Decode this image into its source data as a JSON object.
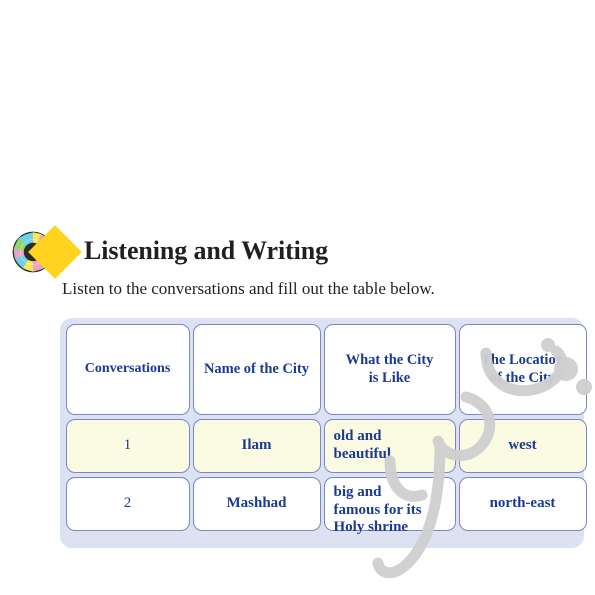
{
  "page": {
    "background": "#ffffff"
  },
  "header": {
    "icons": [
      {
        "name": "cd-disc-icon",
        "label": "cd-disc-icon"
      },
      {
        "name": "diamond-icon",
        "label": "diamond-icon",
        "color": "#ffd320"
      }
    ],
    "title": "Listening and Writing",
    "title_color": "#231f20"
  },
  "instruction": {
    "text": "Listen to the conversations and fill out the table below."
  },
  "table": {
    "panel_color": "#dde2f2",
    "border_color": "#7b87c4",
    "text_color": "#1b3a93",
    "row1_fill": "#fbfbe3",
    "row2_fill": "#ffffff",
    "headers": [
      "Conversations",
      "Name of the City",
      "What the City\nis Like",
      "The Location\nof the City"
    ],
    "headers_lines": [
      [
        "Conversations"
      ],
      [
        "Name of the City"
      ],
      [
        "What the City",
        "is Like"
      ],
      [
        "The Location",
        "of the City"
      ]
    ],
    "rows": [
      {
        "conversation": "1",
        "city": "Ilam",
        "what_is_like": "old and beautiful",
        "what_is_like_lines": [
          "old and",
          "beautiful"
        ],
        "location": "west"
      },
      {
        "conversation": "2",
        "city": "Mashhad",
        "what_is_like": "big and famous for its Holy shrine",
        "what_is_like_lines": [
          "big and",
          "famous for its",
          "Holy shrine"
        ],
        "location": "north-east"
      }
    ]
  },
  "watermark": {
    "description": "persian-script-watermark",
    "color": "#cfcfcf"
  }
}
